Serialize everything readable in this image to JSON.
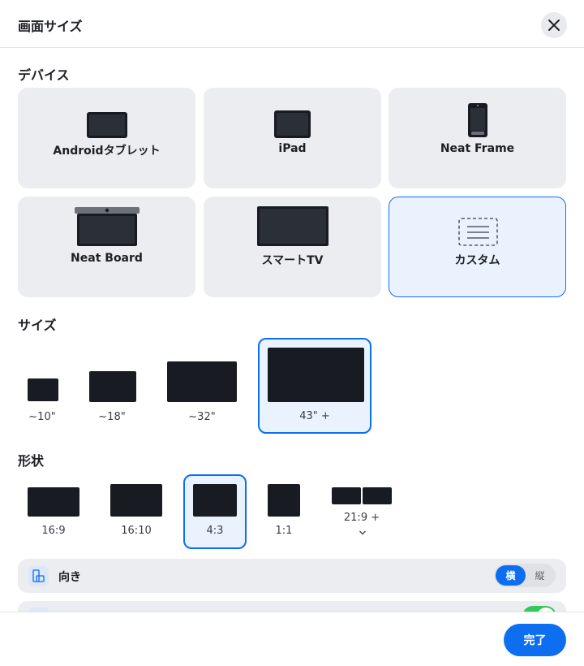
{
  "dialog": {
    "title": "画面サイズ"
  },
  "devices": {
    "section_title": "デバイス",
    "items": [
      {
        "label": "Androidタブレット",
        "icon": "tablet-icon"
      },
      {
        "label": "iPad",
        "icon": "ipad-icon"
      },
      {
        "label": "Neat Frame",
        "icon": "phone-frame-icon"
      },
      {
        "label": "Neat Board",
        "icon": "board-icon"
      },
      {
        "label": "スマートTV",
        "icon": "tv-icon"
      },
      {
        "label": "カスタム",
        "icon": "custom-icon",
        "selected": true
      }
    ]
  },
  "sizes": {
    "section_title": "サイズ",
    "items": [
      {
        "label": "~10\""
      },
      {
        "label": "~18\""
      },
      {
        "label": "~32\""
      },
      {
        "label": "43\" +",
        "selected": true
      }
    ]
  },
  "shapes": {
    "section_title": "形状",
    "items": [
      {
        "label": "16:9"
      },
      {
        "label": "16:10"
      },
      {
        "label": "4:3",
        "selected": true
      },
      {
        "label": "1:1"
      },
      {
        "label": "21:9 +",
        "has_dropdown": true
      }
    ]
  },
  "orientation": {
    "label": "向き",
    "options": [
      "横",
      "縦"
    ],
    "selected": "横"
  },
  "footer": {
    "done_label": "完了"
  },
  "colors": {
    "accent": "#0d6ef0",
    "card_bg": "#ecedf0",
    "selected_bg": "#e9f2fd",
    "screen": "#181b21",
    "toggle_on": "#34c759"
  }
}
